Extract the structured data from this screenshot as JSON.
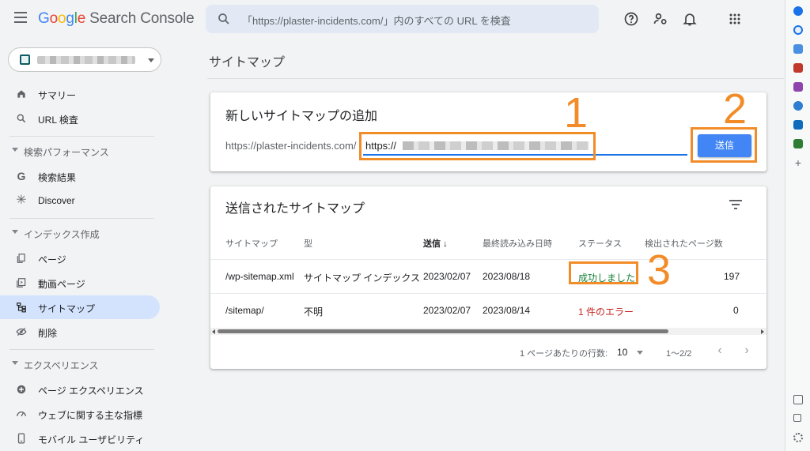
{
  "header": {
    "app_name_letters": [
      "G",
      "o",
      "o",
      "g",
      "l",
      "e"
    ],
    "app_name_rest": "Search Console",
    "search_placeholder": "「https://plaster-incidents.com/」内のすべての URL を検査"
  },
  "sidebar": {
    "property_label": "",
    "items": [
      {
        "label": "サマリー",
        "icon": "home-icon"
      },
      {
        "label": "URL 検査",
        "icon": "search-icon"
      }
    ],
    "section_performance": "検索パフォーマンス",
    "performance_items": [
      {
        "label": "検索結果",
        "icon": "google-g-icon"
      },
      {
        "label": "Discover",
        "icon": "asterisk-icon"
      }
    ],
    "section_index": "インデックス作成",
    "index_items": [
      {
        "label": "ページ",
        "icon": "pages-icon"
      },
      {
        "label": "動画ページ",
        "icon": "video-pages-icon"
      },
      {
        "label": "サイトマップ",
        "icon": "sitemap-icon"
      },
      {
        "label": "削除",
        "icon": "removals-icon"
      }
    ],
    "section_experience": "エクスペリエンス",
    "experience_items": [
      {
        "label": "ページ エクスペリエンス",
        "icon": "plus-circle-icon"
      },
      {
        "label": "ウェブに関する主な指標",
        "icon": "gauge-icon"
      },
      {
        "label": "モバイル ユーザビリティ",
        "icon": "mobile-icon"
      }
    ]
  },
  "main": {
    "page_title": "サイトマップ",
    "add_card": {
      "title": "新しいサイトマップの追加",
      "prefix": "https://plaster-incidents.com/",
      "input_value": "https://",
      "submit_label": "送信"
    },
    "submitted_card": {
      "title": "送信されたサイトマップ",
      "columns": [
        "サイトマップ",
        "型",
        "送信",
        "最終読み込み日時",
        "ステータス",
        "検出されたページ数"
      ],
      "sort_arrow": "↓",
      "rows": [
        {
          "sitemap": "/wp-sitemap.xml",
          "type": "サイトマップ インデックス",
          "submitted": "2023/02/07",
          "last_read": "2023/08/18",
          "status": "成功しました",
          "pages": "197"
        },
        {
          "sitemap": "/sitemap/",
          "type": "不明",
          "submitted": "2023/02/07",
          "last_read": "2023/08/14",
          "status": "1 件のエラー",
          "pages": "0"
        }
      ],
      "pager": {
        "rows_per_page_label": "1 ページあたりの行数:",
        "rows_per_page": "10",
        "range": "1〜2/2",
        "prev": "‹",
        "next": "›"
      }
    }
  },
  "annotations": [
    "1",
    "2",
    "3"
  ],
  "colors": {
    "accent": "#4285f4",
    "annotation": "#f28c28",
    "success": "#188038",
    "error": "#c5221f",
    "active_nav": "#d3e3fd"
  }
}
